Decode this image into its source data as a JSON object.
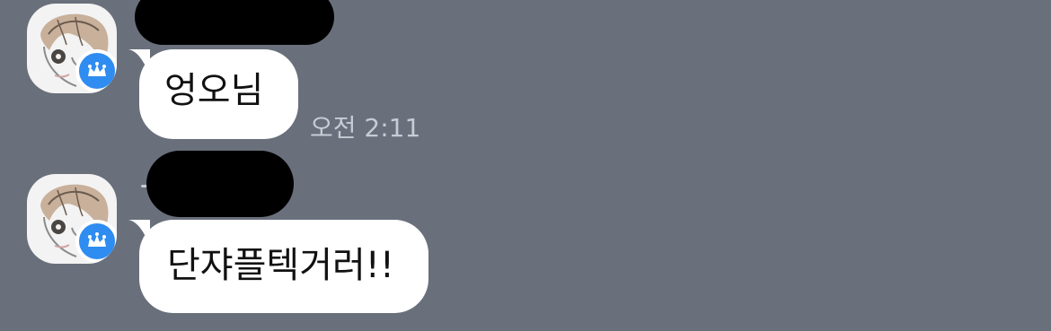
{
  "messages": [
    {
      "text": "엉오님",
      "time": "오전 2:11"
    },
    {
      "text": "단쟈플텍거러!!"
    }
  ],
  "colors": {
    "background": "#69707c",
    "bubble": "#ffffff",
    "timestamp": "#c7ccd4",
    "badge": "#2f8cf0"
  },
  "icons": {
    "avatar": "profile-avatar",
    "badge": "crown-icon"
  }
}
